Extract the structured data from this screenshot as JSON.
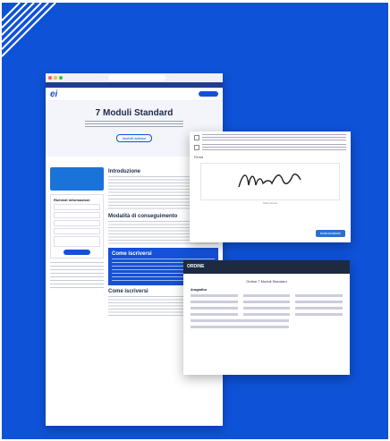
{
  "hero": {
    "title": "7 Moduli Standard",
    "button": "Iscriviti adesso"
  },
  "nav": {
    "logo": "ei"
  },
  "content": {
    "intro_title": "Introduzione",
    "modules_title": "Modalità di conseguimento",
    "box_title": "Come iscriversi",
    "cta_title": "Come iscriversi"
  },
  "form": {
    "title": "Richiedi informazioni",
    "submit": "Invia richiesta"
  },
  "signature": {
    "label": "Firma",
    "signature_text": "Mario Rossi",
    "button": "Invia iscrizione"
  },
  "order": {
    "header": "ORDINE",
    "title": "Ordine 7 Moduli Standard",
    "section": "Anagrafica"
  },
  "colors": {
    "background": "#0e52d8",
    "accent": "#1550d8"
  }
}
